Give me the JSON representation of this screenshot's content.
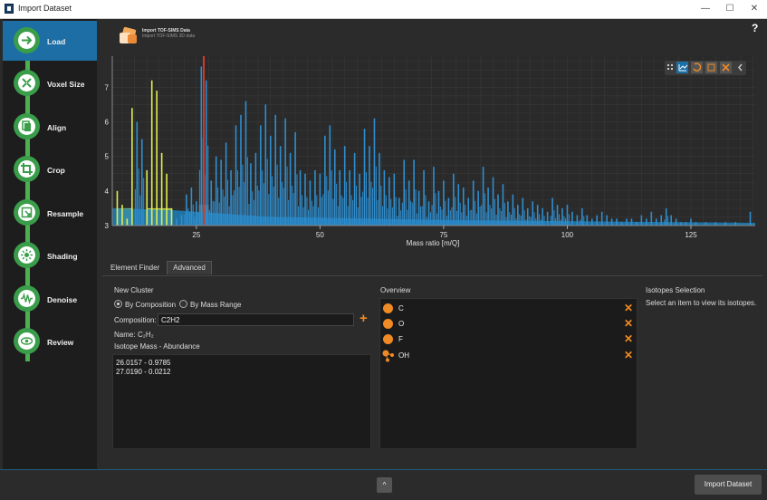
{
  "window": {
    "title": "Import Dataset",
    "min": "—",
    "max": "☐",
    "close": "✕"
  },
  "sidebar": {
    "steps": [
      {
        "label": "Load",
        "icon": "arrow-right-icon",
        "active": true
      },
      {
        "label": "Voxel Size",
        "icon": "compress-icon",
        "active": false
      },
      {
        "label": "Align",
        "icon": "copy-icon",
        "active": false
      },
      {
        "label": "Crop",
        "icon": "crop-icon",
        "active": false
      },
      {
        "label": "Resample",
        "icon": "resample-icon",
        "active": false
      },
      {
        "label": "Shading",
        "icon": "sun-icon",
        "active": false
      },
      {
        "label": "Denoise",
        "icon": "wave-icon",
        "active": false
      },
      {
        "label": "Review",
        "icon": "eye-icon",
        "active": false
      }
    ]
  },
  "header": {
    "line1": "Import TOF-SIMS Data",
    "line2": "Import TOF-SIMS 3D data"
  },
  "chart_data": {
    "type": "bar",
    "xlabel": "Mass ratio [m/Q]",
    "ylabel": "",
    "xlim": [
      8,
      138
    ],
    "ylim": [
      3,
      7.9
    ],
    "xticks": [
      25,
      50,
      75,
      100,
      125
    ],
    "yticks": [
      3,
      4,
      5,
      6,
      7
    ],
    "grid": true,
    "peaks": [
      {
        "x": 9,
        "y": 4.0
      },
      {
        "x": 10,
        "y": 3.6
      },
      {
        "x": 11,
        "y": 3.2
      },
      {
        "x": 12,
        "y": 6.4
      },
      {
        "x": 13,
        "y": 6.0
      },
      {
        "x": 14,
        "y": 5.5
      },
      {
        "x": 15,
        "y": 4.6
      },
      {
        "x": 16,
        "y": 7.2
      },
      {
        "x": 17,
        "y": 6.9
      },
      {
        "x": 18,
        "y": 5.1
      },
      {
        "x": 19,
        "y": 4.5
      },
      {
        "x": 20,
        "y": 3.5
      },
      {
        "x": 21,
        "y": 3.2
      },
      {
        "x": 22,
        "y": 3.3
      },
      {
        "x": 23,
        "y": 3.9
      },
      {
        "x": 24,
        "y": 4.1
      },
      {
        "x": 25,
        "y": 3.7
      },
      {
        "x": 26,
        "y": 7.6
      },
      {
        "x": 27,
        "y": 7.2
      },
      {
        "x": 28,
        "y": 4.3
      },
      {
        "x": 29,
        "y": 5.0
      },
      {
        "x": 30,
        "y": 4.9
      },
      {
        "x": 31,
        "y": 5.4
      },
      {
        "x": 32,
        "y": 4.6
      },
      {
        "x": 33,
        "y": 5.9
      },
      {
        "x": 34,
        "y": 6.2
      },
      {
        "x": 35,
        "y": 6.6
      },
      {
        "x": 36,
        "y": 4.8
      },
      {
        "x": 37,
        "y": 5.1
      },
      {
        "x": 38,
        "y": 5.9
      },
      {
        "x": 39,
        "y": 6.5
      },
      {
        "x": 40,
        "y": 5.6
      },
      {
        "x": 41,
        "y": 6.2
      },
      {
        "x": 42,
        "y": 5.3
      },
      {
        "x": 43,
        "y": 6.1
      },
      {
        "x": 44,
        "y": 5.1
      },
      {
        "x": 45,
        "y": 5.7
      },
      {
        "x": 46,
        "y": 4.6
      },
      {
        "x": 47,
        "y": 4.5
      },
      {
        "x": 48,
        "y": 4.3
      },
      {
        "x": 49,
        "y": 4.6
      },
      {
        "x": 50,
        "y": 4.5
      },
      {
        "x": 51,
        "y": 5.6
      },
      {
        "x": 52,
        "y": 5.9
      },
      {
        "x": 53,
        "y": 5.2
      },
      {
        "x": 54,
        "y": 4.6
      },
      {
        "x": 55,
        "y": 5.3
      },
      {
        "x": 56,
        "y": 4.6
      },
      {
        "x": 57,
        "y": 5.1
      },
      {
        "x": 58,
        "y": 4.5
      },
      {
        "x": 59,
        "y": 5.8
      },
      {
        "x": 60,
        "y": 5.3
      },
      {
        "x": 61,
        "y": 6.1
      },
      {
        "x": 62,
        "y": 5.1
      },
      {
        "x": 63,
        "y": 4.6
      },
      {
        "x": 64,
        "y": 4.4
      },
      {
        "x": 65,
        "y": 4.5
      },
      {
        "x": 66,
        "y": 3.8
      },
      {
        "x": 67,
        "y": 4.9
      },
      {
        "x": 68,
        "y": 4.3
      },
      {
        "x": 69,
        "y": 4.9
      },
      {
        "x": 70,
        "y": 4.0
      },
      {
        "x": 71,
        "y": 4.6
      },
      {
        "x": 72,
        "y": 3.7
      },
      {
        "x": 73,
        "y": 4.7
      },
      {
        "x": 74,
        "y": 4.0
      },
      {
        "x": 75,
        "y": 4.3
      },
      {
        "x": 76,
        "y": 3.8
      },
      {
        "x": 77,
        "y": 4.5
      },
      {
        "x": 78,
        "y": 4.2
      },
      {
        "x": 79,
        "y": 4.1
      },
      {
        "x": 80,
        "y": 3.8
      },
      {
        "x": 81,
        "y": 4.3
      },
      {
        "x": 82,
        "y": 4.0
      },
      {
        "x": 83,
        "y": 4.7
      },
      {
        "x": 84,
        "y": 4.1
      },
      {
        "x": 85,
        "y": 4.4
      },
      {
        "x": 86,
        "y": 3.9
      },
      {
        "x": 87,
        "y": 4.2
      },
      {
        "x": 88,
        "y": 3.7
      },
      {
        "x": 89,
        "y": 3.9
      },
      {
        "x": 90,
        "y": 3.6
      },
      {
        "x": 91,
        "y": 3.8
      },
      {
        "x": 92,
        "y": 3.5
      },
      {
        "x": 93,
        "y": 3.7
      },
      {
        "x": 94,
        "y": 3.6
      },
      {
        "x": 95,
        "y": 3.5
      },
      {
        "x": 96,
        "y": 3.4
      },
      {
        "x": 97,
        "y": 3.8
      },
      {
        "x": 98,
        "y": 3.6
      },
      {
        "x": 99,
        "y": 3.5
      },
      {
        "x": 100,
        "y": 3.6
      },
      {
        "x": 101,
        "y": 3.4
      },
      {
        "x": 102,
        "y": 3.3
      },
      {
        "x": 103,
        "y": 3.5
      },
      {
        "x": 104,
        "y": 3.3
      },
      {
        "x": 105,
        "y": 3.2
      },
      {
        "x": 106,
        "y": 3.3
      },
      {
        "x": 107,
        "y": 3.4
      },
      {
        "x": 108,
        "y": 3.3
      },
      {
        "x": 109,
        "y": 3.2
      },
      {
        "x": 110,
        "y": 3.2
      },
      {
        "x": 111,
        "y": 3.1
      },
      {
        "x": 112,
        "y": 3.2
      },
      {
        "x": 113,
        "y": 3.2
      },
      {
        "x": 114,
        "y": 3.1
      },
      {
        "x": 115,
        "y": 3.3
      },
      {
        "x": 116,
        "y": 3.2
      },
      {
        "x": 117,
        "y": 3.4
      },
      {
        "x": 118,
        "y": 3.2
      },
      {
        "x": 119,
        "y": 3.3
      },
      {
        "x": 120,
        "y": 3.5
      },
      {
        "x": 121,
        "y": 3.3
      },
      {
        "x": 122,
        "y": 3.2
      },
      {
        "x": 123,
        "y": 3.1
      },
      {
        "x": 124,
        "y": 3.1
      },
      {
        "x": 125,
        "y": 3.2
      },
      {
        "x": 126,
        "y": 3.1
      },
      {
        "x": 128,
        "y": 3.1
      },
      {
        "x": 130,
        "y": 3.1
      },
      {
        "x": 132,
        "y": 3.1
      },
      {
        "x": 134,
        "y": 3.1
      },
      {
        "x": 137,
        "y": 3.4
      }
    ],
    "highlight_yellow": [
      [
        9,
        12
      ],
      [
        15,
        20
      ]
    ],
    "highlight_gray": [
      25.5,
      27.5
    ],
    "red_line_x": 26.5
  },
  "chart_toolbar": {
    "icons": [
      "grip-icon",
      "chart-icon",
      "undo-icon",
      "grid-icon",
      "close-icon",
      "chevron-left-icon"
    ]
  },
  "tabs": [
    {
      "label": "Element Finder",
      "active": false
    },
    {
      "label": "Advanced",
      "active": true
    }
  ],
  "new_cluster": {
    "title": "New Cluster",
    "radio1": "By Composition",
    "radio2": "By Mass Range",
    "composition_label": "Composition:",
    "composition_value": "C2H2",
    "name_label": "Name:",
    "name_value": "C₂H₂",
    "isotope_header": "Isotope Mass - Abundance",
    "isotopes": [
      "26.0157 - 0.9785",
      "27.0190 - 0.0212"
    ]
  },
  "overview": {
    "title": "Overview",
    "items": [
      {
        "label": "C",
        "icon": "atom-icon"
      },
      {
        "label": "O",
        "icon": "atom-icon"
      },
      {
        "label": "F",
        "icon": "atom-icon"
      },
      {
        "label": "OH",
        "icon": "molecule-icon"
      }
    ]
  },
  "isotopes_selection": {
    "title": "Isotopes Selection",
    "hint": "Select an item to view its isotopes."
  },
  "footer": {
    "collapse": "^",
    "import_button": "Import Dataset"
  }
}
